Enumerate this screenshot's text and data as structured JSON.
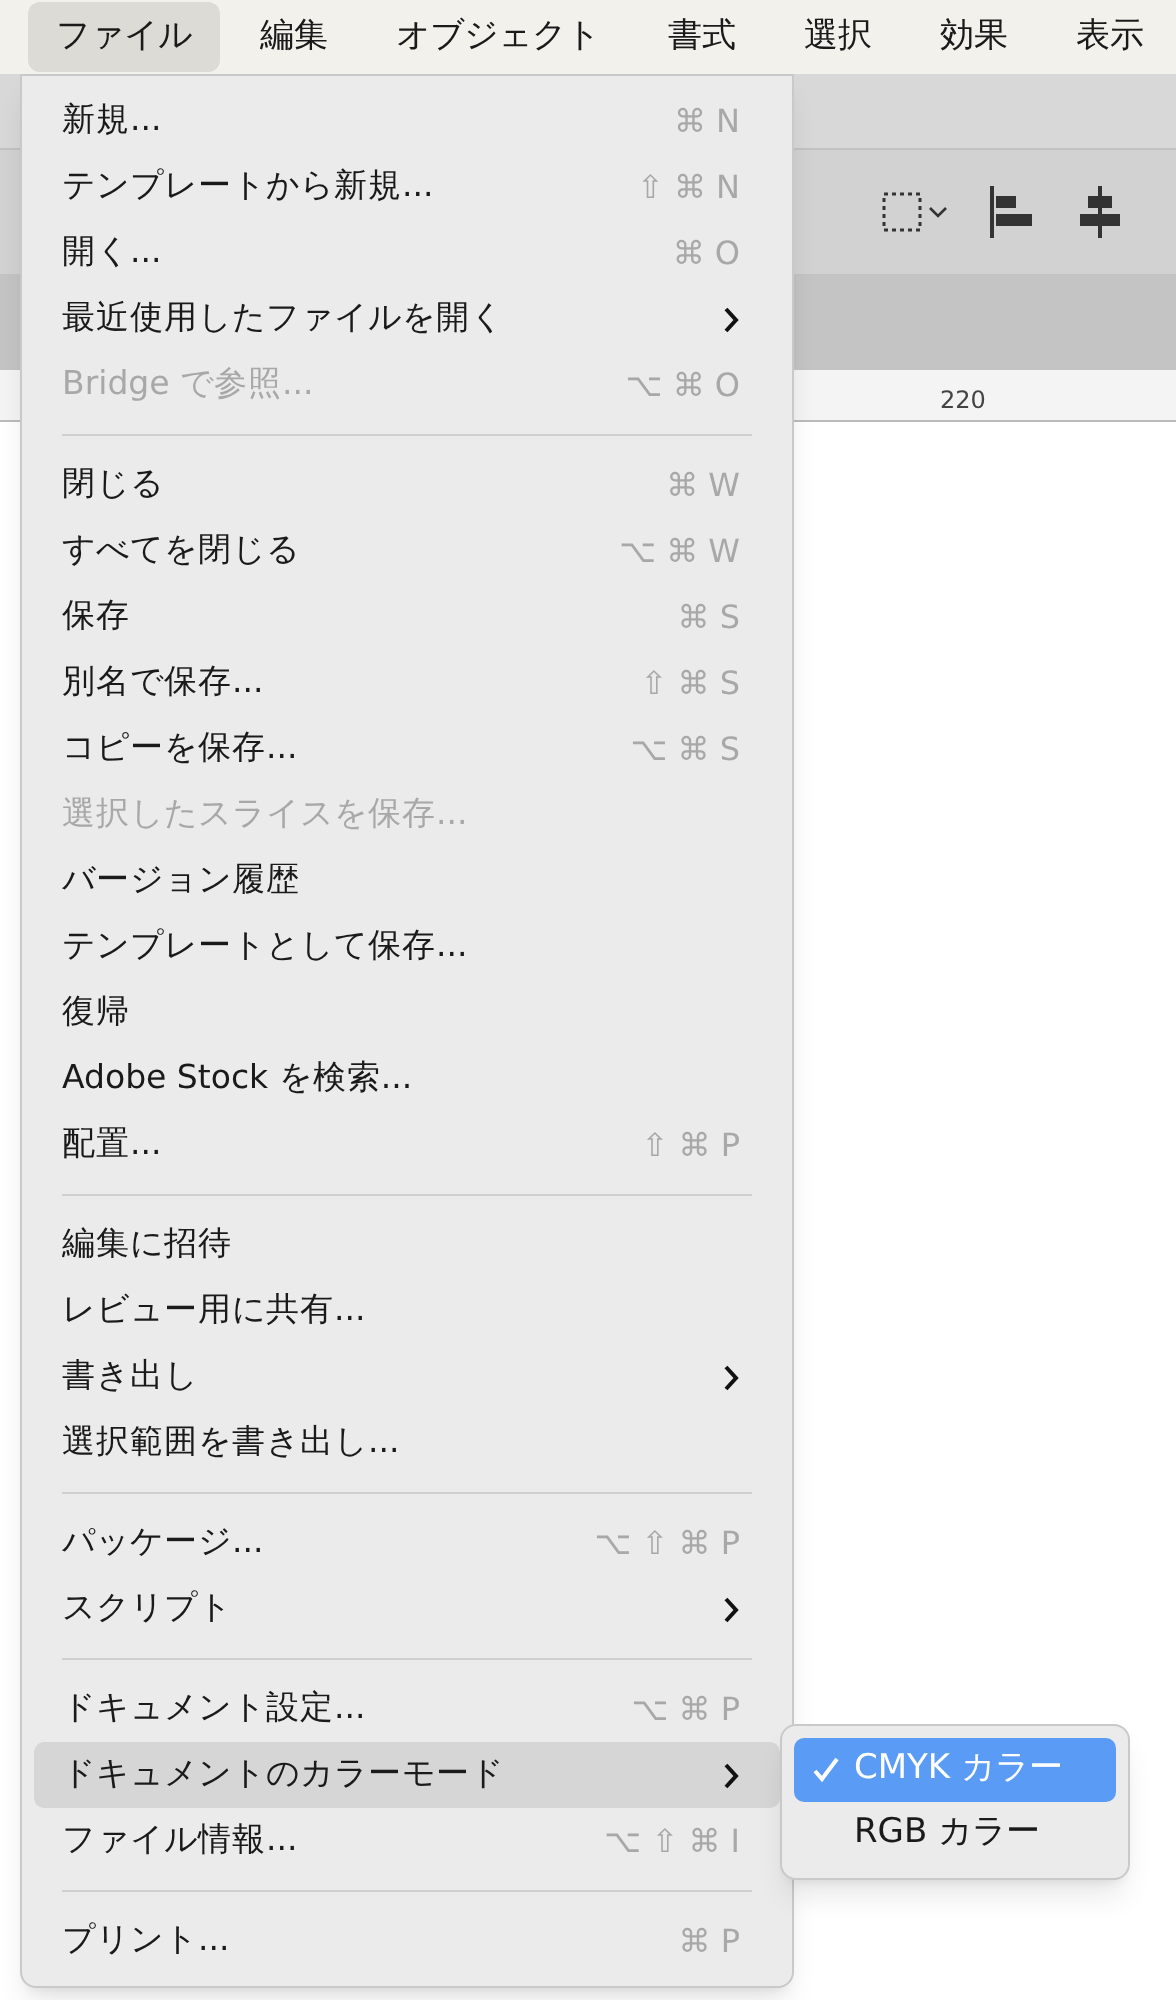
{
  "menubar": [
    {
      "label": "ファイル",
      "selected": true
    },
    {
      "label": "編集",
      "selected": false
    },
    {
      "label": "オブジェクト",
      "selected": false
    },
    {
      "label": "書式",
      "selected": false
    },
    {
      "label": "選択",
      "selected": false
    },
    {
      "label": "効果",
      "selected": false
    },
    {
      "label": "表示",
      "selected": false
    }
  ],
  "ruler": {
    "labels": [
      "220"
    ]
  },
  "file_menu": {
    "sections": [
      [
        {
          "label": "新規...",
          "shortcut": "⌘ N",
          "submenu": false,
          "disabled": false,
          "selected": false
        },
        {
          "label": "テンプレートから新規...",
          "shortcut": "⇧ ⌘ N",
          "submenu": false,
          "disabled": false,
          "selected": false
        },
        {
          "label": "開く...",
          "shortcut": "⌘ O",
          "submenu": false,
          "disabled": false,
          "selected": false
        },
        {
          "label": "最近使用したファイルを開く",
          "submenu": true,
          "disabled": false,
          "selected": false
        },
        {
          "label": "Bridge で参照...",
          "shortcut": "⌥ ⌘ O",
          "submenu": false,
          "disabled": true,
          "selected": false
        }
      ],
      [
        {
          "label": "閉じる",
          "shortcut": "⌘ W",
          "submenu": false,
          "disabled": false,
          "selected": false
        },
        {
          "label": "すべてを閉じる",
          "shortcut": "⌥ ⌘ W",
          "submenu": false,
          "disabled": false,
          "selected": false
        },
        {
          "label": "保存",
          "shortcut": "⌘ S",
          "submenu": false,
          "disabled": false,
          "selected": false
        },
        {
          "label": "別名で保存...",
          "shortcut": "⇧ ⌘ S",
          "submenu": false,
          "disabled": false,
          "selected": false
        },
        {
          "label": "コピーを保存...",
          "shortcut": "⌥ ⌘ S",
          "submenu": false,
          "disabled": false,
          "selected": false
        },
        {
          "label": "選択したスライスを保存...",
          "submenu": false,
          "disabled": true,
          "selected": false
        },
        {
          "label": "バージョン履歴",
          "submenu": false,
          "disabled": false,
          "selected": false
        },
        {
          "label": "テンプレートとして保存...",
          "submenu": false,
          "disabled": false,
          "selected": false
        },
        {
          "label": "復帰",
          "submenu": false,
          "disabled": false,
          "selected": false
        },
        {
          "label": "Adobe Stock を検索...",
          "submenu": false,
          "disabled": false,
          "selected": false
        },
        {
          "label": "配置...",
          "shortcut": "⇧ ⌘ P",
          "submenu": false,
          "disabled": false,
          "selected": false
        }
      ],
      [
        {
          "label": "編集に招待",
          "submenu": false,
          "disabled": false,
          "selected": false
        },
        {
          "label": "レビュー用に共有...",
          "submenu": false,
          "disabled": false,
          "selected": false
        },
        {
          "label": "書き出し",
          "submenu": true,
          "disabled": false,
          "selected": false
        },
        {
          "label": "選択範囲を書き出し...",
          "submenu": false,
          "disabled": false,
          "selected": false
        }
      ],
      [
        {
          "label": "パッケージ...",
          "shortcut": "⌥ ⇧ ⌘ P",
          "submenu": false,
          "disabled": false,
          "selected": false
        },
        {
          "label": "スクリプト",
          "submenu": true,
          "disabled": false,
          "selected": false
        }
      ],
      [
        {
          "label": "ドキュメント設定...",
          "shortcut": "⌥ ⌘ P",
          "submenu": false,
          "disabled": false,
          "selected": false
        },
        {
          "label": "ドキュメントのカラーモード",
          "submenu": true,
          "disabled": false,
          "selected": true
        },
        {
          "label": "ファイル情報...",
          "shortcut": "⌥ ⇧ ⌘ I",
          "submenu": false,
          "disabled": false,
          "selected": false
        }
      ],
      [
        {
          "label": "プリント...",
          "shortcut": "⌘ P",
          "submenu": false,
          "disabled": false,
          "selected": false
        }
      ]
    ]
  },
  "color_mode_submenu": [
    {
      "label": "CMYK カラー",
      "checked": true,
      "selected": true
    },
    {
      "label": "RGB カラー",
      "checked": false,
      "selected": false
    }
  ]
}
